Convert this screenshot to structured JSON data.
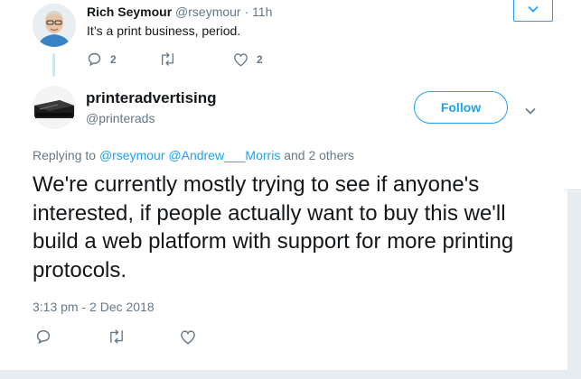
{
  "top_tweet": {
    "name": "Rich Seymour",
    "handle": "@rseymour",
    "dot": "·",
    "time": "11h",
    "text": "It’s a print business, period.",
    "reply_count": "2",
    "like_count": "2"
  },
  "main_tweet": {
    "name": "printeradvertising",
    "handle": "@printerads",
    "follow_label": "Follow",
    "replying_prefix": "Replying to ",
    "mention_1": "@rseymour",
    "mention_2": "@Andrew___Morris",
    "replying_suffix": " and 2 others",
    "text": "We're currently mostly trying to see if anyone's interested, if people actually want to buy this we'll build a web platform with support for more printing protocols.",
    "timestamp": "3:13 pm - 2 Dec 2018"
  },
  "colors": {
    "accent": "#1da1f2",
    "text_primary": "#14171a",
    "text_secondary": "#657786",
    "thread_line": "#cce9ef"
  },
  "icons": [
    "reply-icon",
    "retweet-icon",
    "like-icon",
    "chevron-down-icon"
  ]
}
